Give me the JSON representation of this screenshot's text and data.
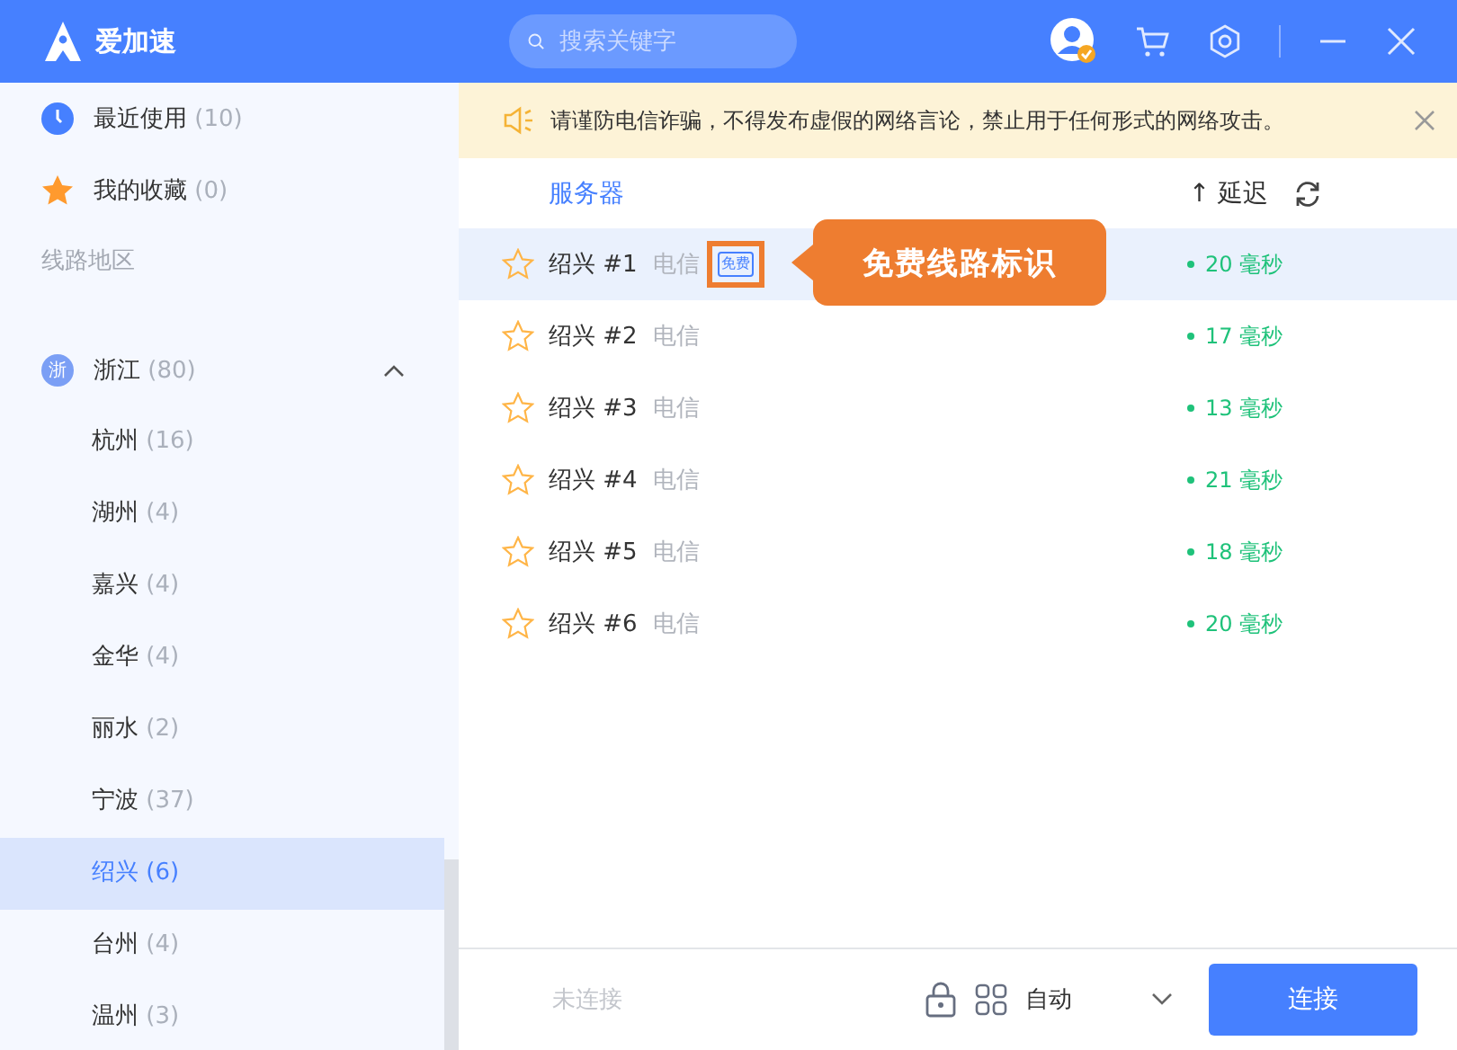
{
  "app": {
    "name": "爱加速"
  },
  "search": {
    "placeholder": "搜索关键字"
  },
  "sidebar": {
    "pinned": [
      {
        "kind": "clock",
        "label": "最近使用",
        "count": "(10)"
      },
      {
        "kind": "star",
        "label": "我的收藏",
        "count": "(0)"
      }
    ],
    "section_title": "线路地区",
    "regions": [
      {
        "badge": "浙",
        "label": "浙江",
        "count": "(80)",
        "expanded": true,
        "children": [
          {
            "label": "杭州",
            "count": "(16)",
            "selected": false
          },
          {
            "label": "湖州",
            "count": "(4)",
            "selected": false
          },
          {
            "label": "嘉兴",
            "count": "(4)",
            "selected": false
          },
          {
            "label": "金华",
            "count": "(4)",
            "selected": false
          },
          {
            "label": "丽水",
            "count": "(2)",
            "selected": false
          },
          {
            "label": "宁波",
            "count": "(37)",
            "selected": false
          },
          {
            "label": "绍兴",
            "count": "(6)",
            "selected": true
          },
          {
            "label": "台州",
            "count": "(4)",
            "selected": false
          },
          {
            "label": "温州",
            "count": "(3)",
            "selected": false
          }
        ]
      }
    ]
  },
  "notice": {
    "text": "请谨防电信诈骗，不得发布虚假的网络言论，禁止用于任何形式的网络攻击。"
  },
  "table": {
    "columns": [
      "服务器",
      "延迟"
    ],
    "sort_arrow": "↑",
    "rows": [
      {
        "name": "绍兴 #1",
        "isp": "电信",
        "badge": "免费",
        "latency": "20 毫秒",
        "selected": true,
        "favorite": false
      },
      {
        "name": "绍兴 #2",
        "isp": "电信",
        "latency": "17 毫秒",
        "selected": false,
        "favorite": false
      },
      {
        "name": "绍兴 #3",
        "isp": "电信",
        "latency": "13 毫秒",
        "selected": false,
        "favorite": false
      },
      {
        "name": "绍兴 #4",
        "isp": "电信",
        "latency": "21 毫秒",
        "selected": false,
        "favorite": false
      },
      {
        "name": "绍兴 #5",
        "isp": "电信",
        "latency": "18 毫秒",
        "selected": false,
        "favorite": false
      },
      {
        "name": "绍兴 #6",
        "isp": "电信",
        "latency": "20 毫秒",
        "selected": false,
        "favorite": false
      }
    ]
  },
  "callout": {
    "text": "免费线路标识"
  },
  "footer": {
    "status": "未连接",
    "mode": "自动",
    "connect_button": "连接"
  }
}
